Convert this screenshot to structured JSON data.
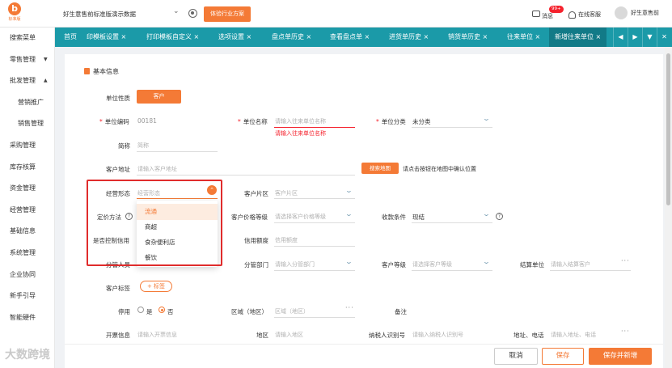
{
  "top": {
    "company_name": "好生意售前标准版演示数据",
    "trial_button": "体验行业方案",
    "messages_label": "消息",
    "messages_badge": "99+",
    "online_service": "在线客服",
    "user_name": "好生意售前"
  },
  "sidebar": {
    "items": [
      {
        "label": "搜索菜单"
      },
      {
        "label": "零售管理",
        "arrow": "▼"
      },
      {
        "label": "批发管理",
        "arrow": "▲"
      },
      {
        "label": "营销推广"
      },
      {
        "label": "销售管理"
      },
      {
        "label": "采购管理"
      },
      {
        "label": "库存核算"
      },
      {
        "label": "资金管理"
      },
      {
        "label": "经营管理"
      },
      {
        "label": "基础信息"
      },
      {
        "label": "系统管理"
      },
      {
        "label": "企业协同"
      },
      {
        "label": "新手引导"
      },
      {
        "label": "智能硬件"
      }
    ]
  },
  "tabs": [
    {
      "label": "首页"
    },
    {
      "label": "印模板设置 ×"
    },
    {
      "label": "打印模板自定义 ×"
    },
    {
      "label": "选项设置 ×"
    },
    {
      "label": "盘点单历史 ×"
    },
    {
      "label": "查看盘点单 ×"
    },
    {
      "label": "进货单历史 ×"
    },
    {
      "label": "销货单历史 ×"
    },
    {
      "label": "往来单位 ×"
    },
    {
      "label": "新增往来单位 ×"
    }
  ],
  "tab_controls": {
    "prev": "◀",
    "next": "▶",
    "down": "▼",
    "close": "✕"
  },
  "section_title": "基本信息",
  "form": {
    "unit_type_label": "单位性质",
    "unit_type_value": "客户",
    "unit_code_label": "单位编码",
    "unit_code_value": "00181",
    "unit_name_label": "单位名称",
    "unit_name_placeholder": "请输入往来单位名称",
    "unit_name_error": "请输入往来单位名称",
    "unit_category_label": "单位分类",
    "unit_category_value": "未分类",
    "short_name_label": "简称",
    "short_name_placeholder": "简称",
    "address_label": "客户地址",
    "address_placeholder": "请输入客户地址",
    "map_button": "搜索地图",
    "map_hint": "请点击按钮在地图中确认位置",
    "business_form_label": "经营形态",
    "business_form_placeholder": "经营形态",
    "customer_area_label": "客户片区",
    "customer_area_placeholder": "客户片区",
    "pricing_label": "定价方法",
    "price_level_label": "客户价格等级",
    "price_level_placeholder": "请选择客户价格等级",
    "payment_terms_label": "收款条件",
    "payment_terms_value": "现结",
    "credit_control_label": "是否控制信用",
    "credit_limit_label": "信用额度",
    "credit_limit_placeholder": "信用额度",
    "staff_label": "分管人员",
    "dept_label": "分管部门",
    "dept_placeholder": "请输入分管部门",
    "customer_level_label": "客户等级",
    "customer_level_placeholder": "请选择客户等级",
    "settle_unit_label": "结算单位",
    "settle_unit_placeholder": "请输入结算客户",
    "tags_label": "客户标签",
    "tags_button": "+ 标签",
    "disabled_label": "停用",
    "disabled_yes": "是",
    "disabled_no": "否",
    "region_label": "区域（地区）",
    "region_placeholder": "区域（地区）",
    "remark_label": "备注",
    "invoice_label": "开票信息",
    "invoice_placeholder": "请输入开票信息",
    "region2_label": "地区",
    "region2_placeholder": "请输入地区",
    "tax_id_label": "纳税人识别号",
    "tax_id_placeholder": "请输入纳税人识别号",
    "addr_phone_label": "地址、电话",
    "addr_phone_placeholder": "请输入地址、电话"
  },
  "dropdown": {
    "selected": "流通",
    "options": [
      "流通",
      "商超",
      "食杂便利店",
      "餐饮"
    ]
  },
  "footer": {
    "cancel": "取消",
    "save": "保存",
    "save_new": "保存并新增"
  },
  "watermark": "大数跨境",
  "colors": {
    "accent": "#f47a36",
    "tabbar": "#1b9aa8",
    "error": "#f5222d"
  }
}
